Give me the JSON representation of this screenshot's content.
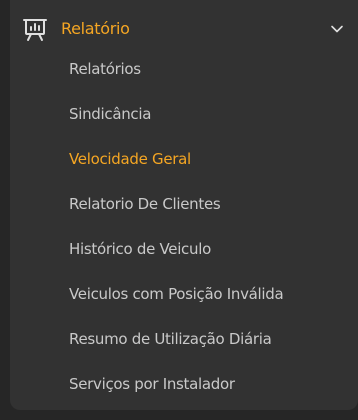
{
  "colors": {
    "accent": "#f5a623",
    "text_muted": "#c9c9c9",
    "icon": "#e0e0e0",
    "panel_bg": "#323232",
    "page_bg": "#262626"
  },
  "menu": {
    "header": {
      "label": "Relatório",
      "icon": "presentation-chart-icon",
      "expanded": true
    },
    "items": [
      {
        "label": "Relatórios",
        "active": false
      },
      {
        "label": "Sindicância",
        "active": false
      },
      {
        "label": "Velocidade Geral",
        "active": true
      },
      {
        "label": "Relatorio De Clientes",
        "active": false
      },
      {
        "label": "Histórico de Veiculo",
        "active": false
      },
      {
        "label": "Veiculos com Posição Inválida",
        "active": false
      },
      {
        "label": "Resumo de Utilização Diária",
        "active": false
      },
      {
        "label": "Serviços por Instalador",
        "active": false
      }
    ]
  }
}
